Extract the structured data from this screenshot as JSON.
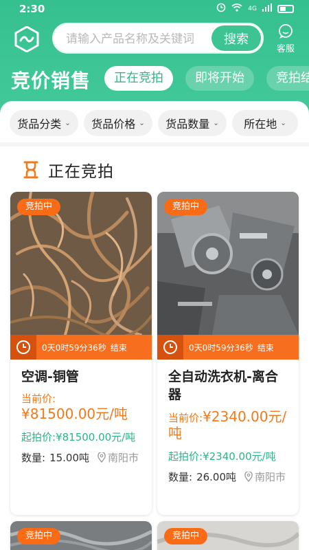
{
  "status_bar": {
    "time": "2:30",
    "network": "4G"
  },
  "search": {
    "placeholder": "请输入产品名称及关键词",
    "button_label": "搜索"
  },
  "service": {
    "label": "客服"
  },
  "page_title": "竞价销售",
  "tabs": [
    {
      "label": "正在竞拍",
      "active": true
    },
    {
      "label": "即将开始",
      "active": false
    },
    {
      "label": "竞拍结",
      "active": false
    }
  ],
  "filters": [
    {
      "label": "货品分类"
    },
    {
      "label": "货品价格"
    },
    {
      "label": "货品数量"
    },
    {
      "label": "所在地"
    }
  ],
  "section_title": "正在竞拍",
  "products": [
    {
      "badge": "竞拍中",
      "countdown": "0天0时59分36秒",
      "countdown_suffix": "结束",
      "name": "空调-铜管",
      "current_price_label": "当前价:",
      "current_price": "¥81500.00元/吨",
      "start_price_label": "起拍价:",
      "start_price": "¥81500.00元/吨",
      "quantity_label": "数量:",
      "quantity": "15.00吨",
      "location": "南阳市"
    },
    {
      "badge": "竞拍中",
      "countdown": "0天0时59分36秒",
      "countdown_suffix": "结束",
      "name": "全自动洗衣机-离合器",
      "current_price_label": "当前价:",
      "current_price": "¥2340.00元/吨",
      "start_price_label": "起拍价:",
      "start_price": "¥2340.00元/吨",
      "quantity_label": "数量:",
      "quantity": "26.00吨",
      "location": "南阳市"
    },
    {
      "badge": "竞拍中"
    },
    {
      "badge": "竞拍中"
    }
  ],
  "colors": {
    "brand_green": "#3ec493",
    "accent_orange": "#fa6b16",
    "start_price_teal": "#2cb38a"
  }
}
